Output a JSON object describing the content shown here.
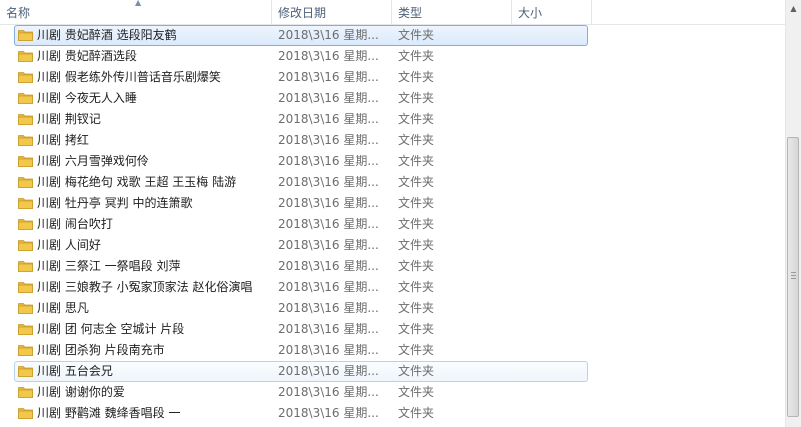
{
  "columns": {
    "name": "名称",
    "modified": "修改日期",
    "type": "类型",
    "size": "大小"
  },
  "rows": [
    {
      "name": "川剧 贵妃醉酒 选段阳友鹤",
      "date": "2018\\3\\16 星期...",
      "type": "文件夹",
      "state": "selected"
    },
    {
      "name": "川剧 贵妃醉酒选段",
      "date": "2018\\3\\16 星期...",
      "type": "文件夹",
      "state": ""
    },
    {
      "name": "川剧 假老练外传川普话音乐剧爆笑",
      "date": "2018\\3\\16 星期...",
      "type": "文件夹",
      "state": ""
    },
    {
      "name": "川剧 今夜无人入睡",
      "date": "2018\\3\\16 星期...",
      "type": "文件夹",
      "state": ""
    },
    {
      "name": "川剧 荆钗记",
      "date": "2018\\3\\16 星期...",
      "type": "文件夹",
      "state": ""
    },
    {
      "name": "川剧 拷红",
      "date": "2018\\3\\16 星期...",
      "type": "文件夹",
      "state": ""
    },
    {
      "name": "川剧 六月雪弹戏何伶",
      "date": "2018\\3\\16 星期...",
      "type": "文件夹",
      "state": ""
    },
    {
      "name": "川剧 梅花绝句 戏歌 王超 王玉梅 陆游",
      "date": "2018\\3\\16 星期...",
      "type": "文件夹",
      "state": ""
    },
    {
      "name": "川剧 牡丹亭 冥判 中的连箫歌",
      "date": "2018\\3\\16 星期...",
      "type": "文件夹",
      "state": ""
    },
    {
      "name": "川剧 闹台吹打",
      "date": "2018\\3\\16 星期...",
      "type": "文件夹",
      "state": ""
    },
    {
      "name": "川剧 人间好",
      "date": "2018\\3\\16 星期...",
      "type": "文件夹",
      "state": ""
    },
    {
      "name": "川剧 三祭江 一祭唱段 刘萍",
      "date": "2018\\3\\16 星期...",
      "type": "文件夹",
      "state": ""
    },
    {
      "name": "川剧 三娘教子 小冤家顶家法 赵化俗演唱",
      "date": "2018\\3\\16 星期...",
      "type": "文件夹",
      "state": ""
    },
    {
      "name": "川剧 思凡",
      "date": "2018\\3\\16 星期...",
      "type": "文件夹",
      "state": ""
    },
    {
      "name": "川剧 团 何志全 空城计 片段",
      "date": "2018\\3\\16 星期...",
      "type": "文件夹",
      "state": ""
    },
    {
      "name": "川剧 团杀狗 片段南充市",
      "date": "2018\\3\\16 星期...",
      "type": "文件夹",
      "state": ""
    },
    {
      "name": "川剧 五台会兄",
      "date": "2018\\3\\16 星期...",
      "type": "文件夹",
      "state": "hovered"
    },
    {
      "name": "川剧 谢谢你的爱",
      "date": "2018\\3\\16 星期...",
      "type": "文件夹",
      "state": ""
    },
    {
      "name": "川剧 野鹳滩 魏绛香唱段 一",
      "date": "2018\\3\\16 星期...",
      "type": "文件夹",
      "state": ""
    }
  ],
  "icons": {
    "folder": "folder-icon",
    "sort": "sort-ascending-icon",
    "scroll_up": "scroll-up-arrow-icon"
  },
  "colors": {
    "selection_border": "#84acdd",
    "hover_border": "#b8d1f0",
    "header_text": "#4c607a",
    "folder": "#f2c84b"
  }
}
